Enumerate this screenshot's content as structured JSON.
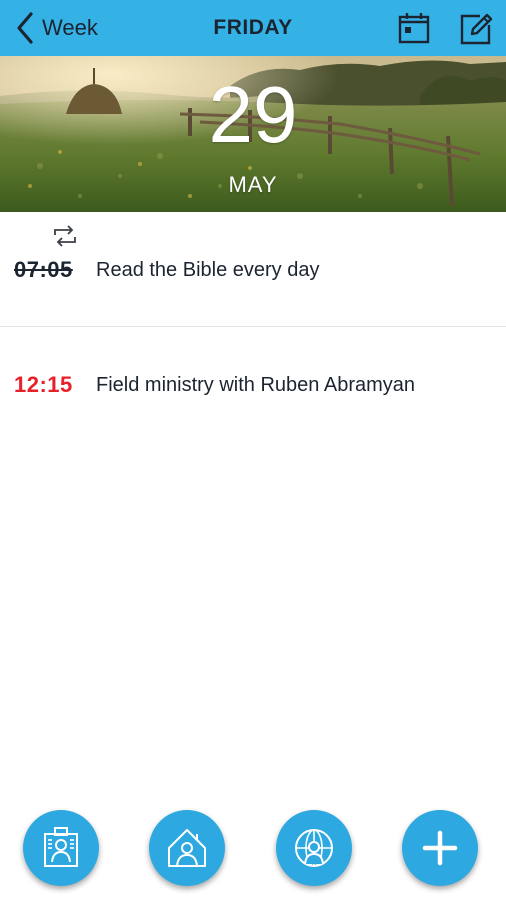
{
  "header": {
    "back_label": "Week",
    "title": "FRIDAY",
    "back_icon": "chevron-left-icon",
    "calendar_icon": "calendar-icon",
    "edit_icon": "edit-icon"
  },
  "hero": {
    "day": "29",
    "month": "MAY"
  },
  "events": [
    {
      "time": "07:05",
      "title": "Read the Bible every day",
      "repeating": true,
      "completed": true,
      "time_color": "#1b2430"
    },
    {
      "time": "12:15",
      "title": "Field ministry with Ruben Abramyan",
      "repeating": false,
      "completed": false,
      "time_color": "#e8202a"
    }
  ],
  "actions": [
    {
      "name": "contact-card",
      "icon": "contact-card-icon"
    },
    {
      "name": "householder",
      "icon": "house-person-icon"
    },
    {
      "name": "territory",
      "icon": "globe-person-icon"
    },
    {
      "name": "add",
      "icon": "plus-icon"
    }
  ],
  "colors": {
    "accent": "#34b2e6",
    "fab": "#2ea8e0",
    "overdue": "#e8202a",
    "text": "#1b2430"
  }
}
